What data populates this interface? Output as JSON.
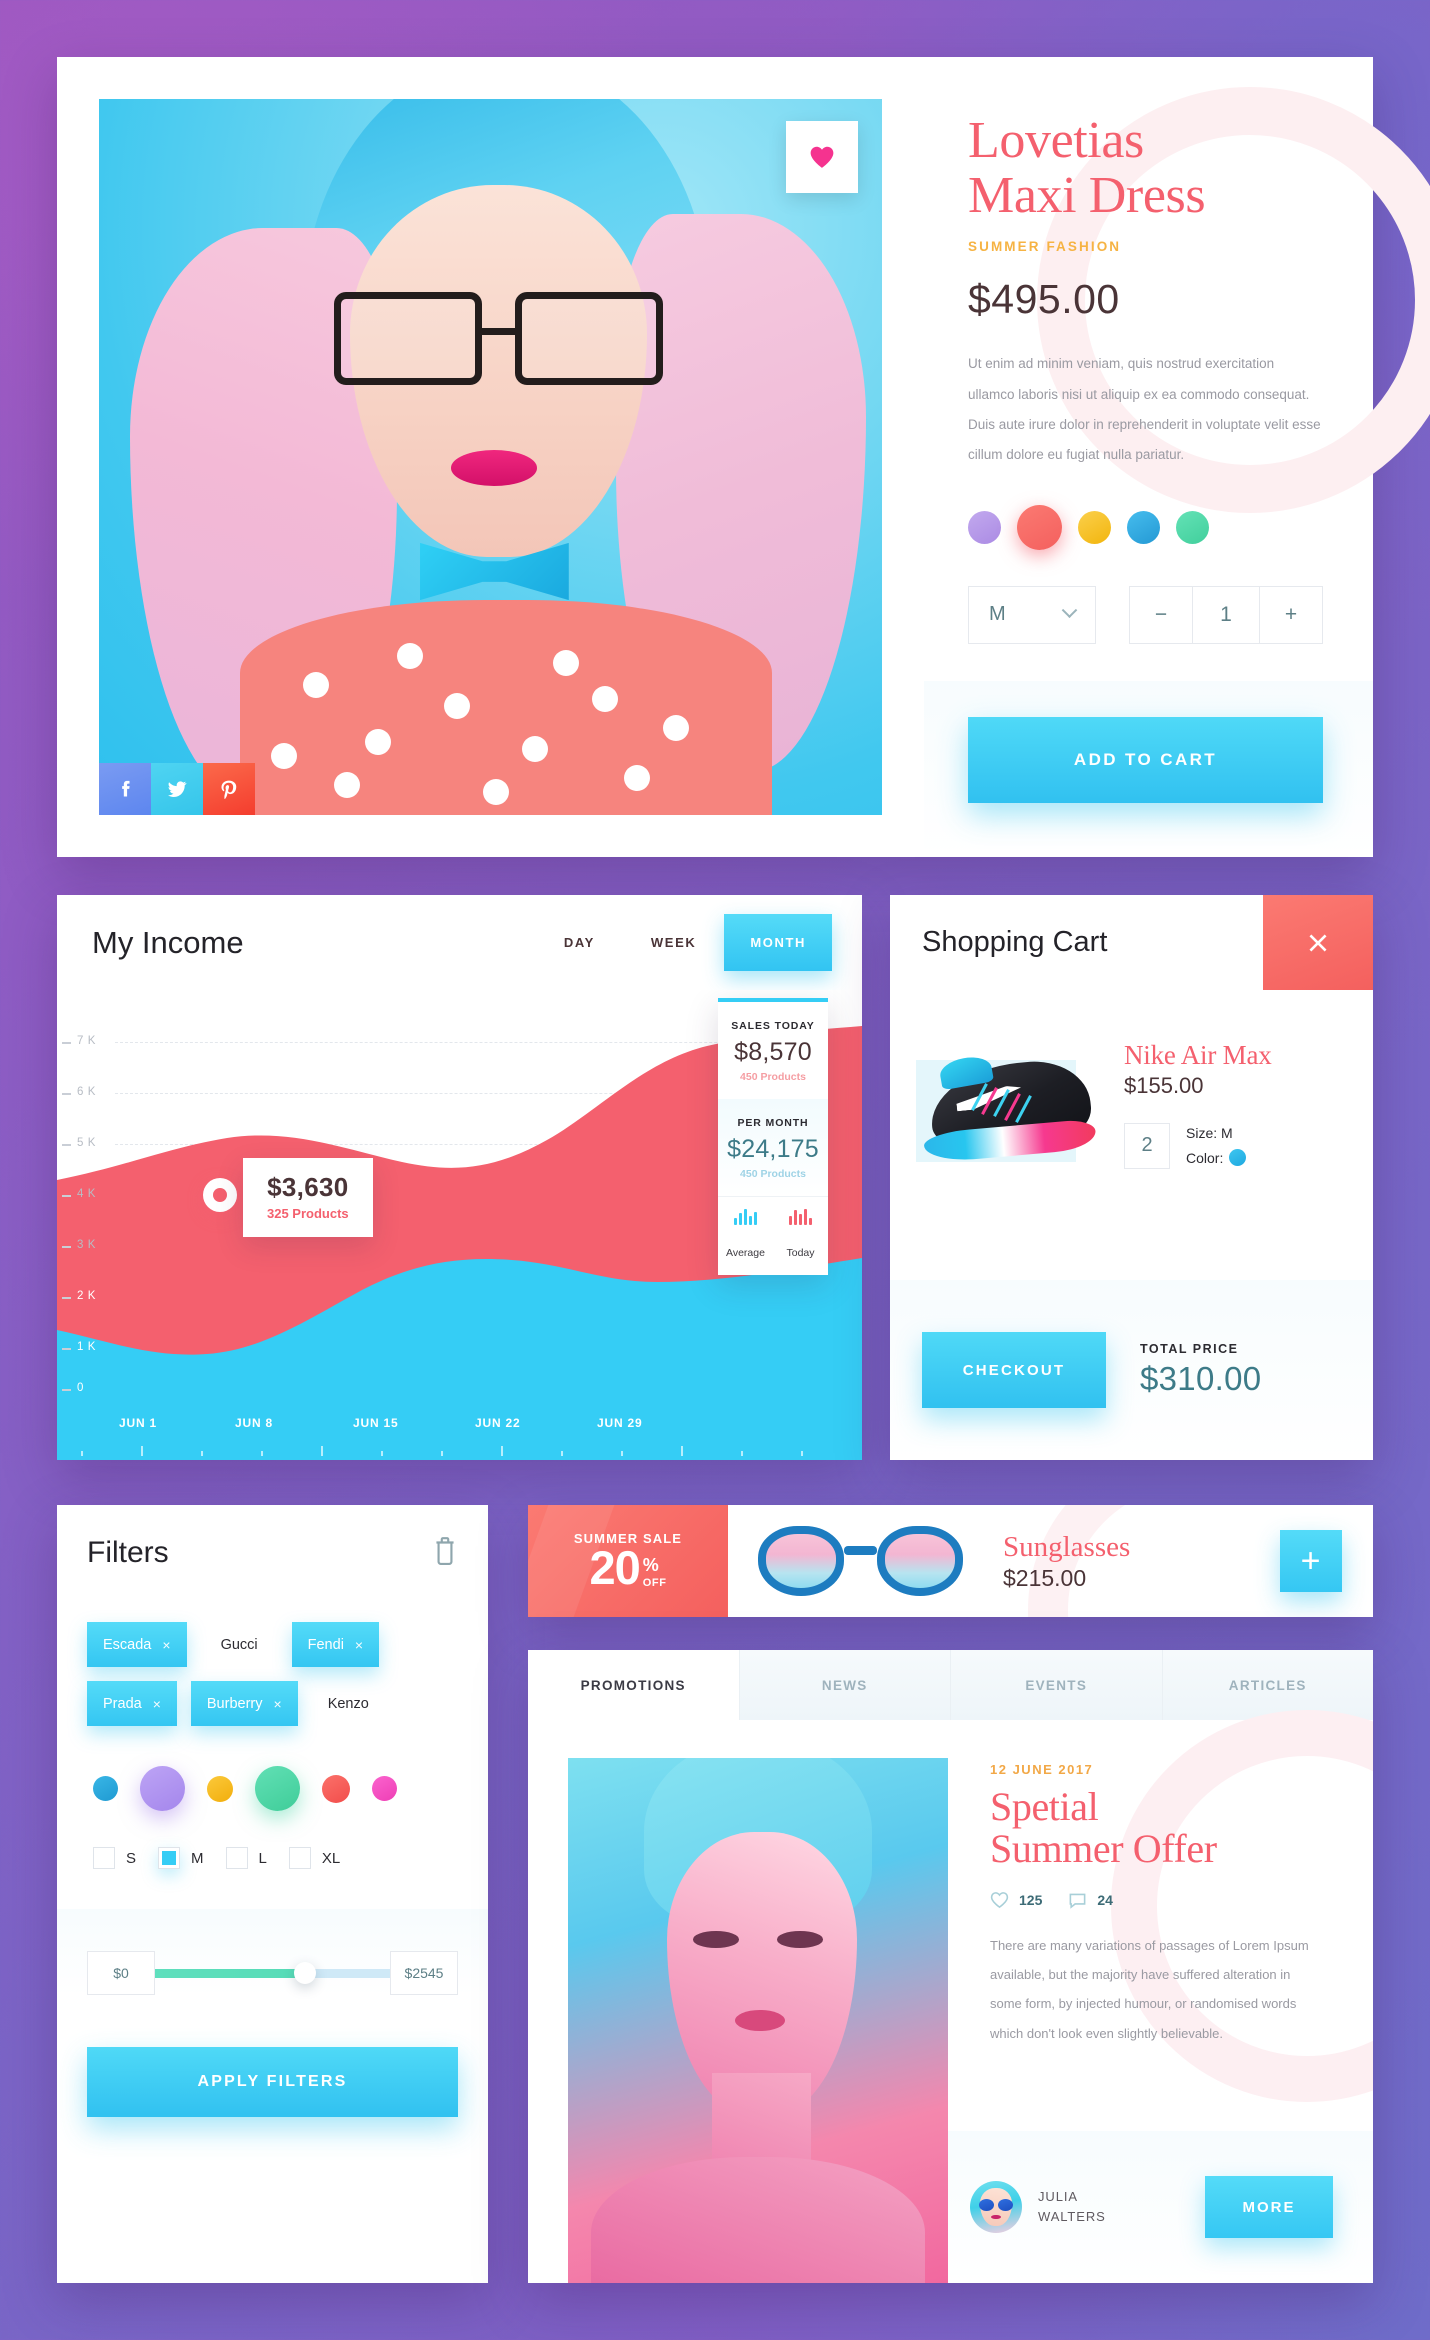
{
  "product": {
    "title_line1": "Lovetias",
    "title_line2": "Maxi Dress",
    "subtitle": "SUMMER FASHION",
    "price": "$495.00",
    "description": "Ut enim ad minim veniam, quis nostrud exercitation ullamco laboris nisi ut aliquip ex ea commodo consequat. Duis aute irure dolor in reprehenderit in voluptate velit esse cillum dolore eu fugiat nulla pariatur.",
    "swatches": [
      "#b69ae8",
      "#f4605e",
      "#f7c320",
      "#35aee0",
      "#4fd9a8"
    ],
    "active_swatch_index": 1,
    "size_value": "M",
    "quantity": "1",
    "minus_label": "−",
    "plus_label": "+",
    "add_to_cart_label": "ADD TO CART",
    "favorite_icon": "heart-icon",
    "social": [
      "facebook-icon",
      "twitter-icon",
      "pinterest-icon"
    ]
  },
  "income": {
    "title": "My Income",
    "ranges": [
      "DAY",
      "WEEK",
      "MONTH"
    ],
    "active_range": "MONTH",
    "tooltip": {
      "value": "$3,630",
      "products": "325 Products"
    },
    "stats": [
      {
        "label": "SALES TODAY",
        "value": "$8,570",
        "products": "450 Products"
      },
      {
        "label": "PER MONTH",
        "value": "$24,175",
        "products": "450 Products"
      }
    ],
    "legend": [
      {
        "label": "Average",
        "color": "#35cdf5"
      },
      {
        "label": "Today",
        "color": "#f4606e"
      }
    ]
  },
  "chart_data": {
    "type": "area",
    "title": "My Income",
    "xlabel": "",
    "ylabel": "",
    "ylim": [
      0,
      7500
    ],
    "yticks": [
      "0",
      "1 K",
      "2 K",
      "3 K",
      "4 K",
      "5 K",
      "6 K",
      "7 K"
    ],
    "ytick_values": [
      0,
      1000,
      2000,
      3000,
      4000,
      5000,
      6000,
      7000
    ],
    "categories": [
      "JUN 1",
      "JUN 8",
      "JUN 15",
      "JUN 22",
      "JUN 29"
    ],
    "x": [
      0,
      7,
      14,
      21,
      28
    ],
    "grid": true,
    "legend_position": "right-panel",
    "series": [
      {
        "name": "Today",
        "color": "#f4606e",
        "values": [
          2900,
          3150,
          3630,
          3900,
          3400,
          3200,
          4100,
          5200,
          5600
        ]
      },
      {
        "name": "Average",
        "color": "#35cdf5",
        "values": [
          950,
          600,
          700,
          1250,
          2050,
          2000,
          1800,
          2150,
          2500
        ]
      }
    ],
    "annotation": {
      "x": 7,
      "y": 3630,
      "value": "$3,630",
      "sub": "325 Products"
    }
  },
  "cart": {
    "title": "Shopping Cart",
    "close_icon": "close-icon",
    "item": {
      "name": "Nike Air Max",
      "price": "$155.00",
      "quantity": "2",
      "size_label": "Size: M",
      "color_label": "Color:",
      "color_value": "#2fb6e8"
    },
    "checkout_label": "CHECKOUT",
    "total_label": "TOTAL PRICE",
    "total_value": "$310.00"
  },
  "filters": {
    "title": "Filters",
    "trash_icon": "trash-icon",
    "brands": [
      {
        "label": "Escada",
        "selected": true
      },
      {
        "label": "Gucci",
        "selected": false
      },
      {
        "label": "Fendi",
        "selected": true
      },
      {
        "label": "Prada",
        "selected": true
      },
      {
        "label": "Burberry",
        "selected": true
      },
      {
        "label": "Kenzo",
        "selected": false
      }
    ],
    "remove_icon": "×",
    "colors": [
      "#2ba8dd",
      "#ad8ff0",
      "#f7bb1c",
      "#4ed8a8",
      "#f4605e",
      "#f750c0"
    ],
    "color_selected_indexes": [
      1,
      3
    ],
    "sizes": [
      {
        "label": "S",
        "checked": false
      },
      {
        "label": "M",
        "checked": true
      },
      {
        "label": "L",
        "checked": false
      },
      {
        "label": "XL",
        "checked": false
      }
    ],
    "price_min": "$0",
    "price_max": "$2545",
    "apply_label": "APPLY FILTERS"
  },
  "sale": {
    "badge_label": "SUMMER SALE",
    "badge_number": "20",
    "badge_pct": "%",
    "badge_off": "OFF",
    "product_name": "Sunglasses",
    "product_price": "$215.00",
    "add_label": "+"
  },
  "promo": {
    "tabs": [
      {
        "label": "PROMOTIONS",
        "active": true
      },
      {
        "label": "NEWS",
        "active": false
      },
      {
        "label": "EVENTS",
        "active": false
      },
      {
        "label": "ARTICLES",
        "active": false
      }
    ],
    "date": "12 JUNE 2017",
    "heading_line1": "Spetial",
    "heading_line2": "Summer Offer",
    "likes": "125",
    "comments": "24",
    "like_icon": "heart-outline-icon",
    "comment_icon": "comment-icon",
    "body": "There are many variations of passages of Lorem Ipsum available, but the majority have suffered alteration in some form, by injected humour, or randomised words which don't look even slightly believable.",
    "author_line1": "JULIA",
    "author_line2": "WALTERS",
    "more_label": "MORE"
  }
}
